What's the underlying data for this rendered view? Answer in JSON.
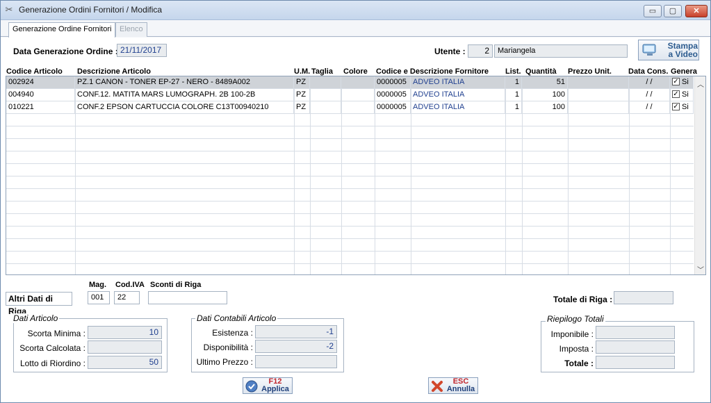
{
  "window": {
    "title": "Generazione Ordini Fornitori / Modifica",
    "minimize": "▭",
    "maximize": "▢",
    "close": "✕"
  },
  "tabs": [
    {
      "label": "Generazione Ordine Fornitori"
    },
    {
      "label": "Elenco"
    }
  ],
  "header": {
    "data_label": "Data Generazione Ordine :",
    "data_value": "21/11/2017",
    "utente_label": "Utente :",
    "utente_id": "2",
    "utente_name": "Mariangela",
    "stampa_label_1": "Stampa",
    "stampa_label_2": "a Video"
  },
  "table": {
    "columns": [
      "Codice Articolo",
      "Descrizione Articolo",
      "U.M.",
      "Taglia",
      "Colore",
      "Codice e Descrizione Fornitore",
      "List.",
      "Quantità",
      "Prezzo Unit.",
      "Data Cons.",
      "Genera"
    ],
    "rows": [
      {
        "codice": "002924",
        "descrizione": "PZ.1 CANON - TONER EP-27 - NERO - 8489A002",
        "um": "PZ",
        "taglia": "",
        "colore": "",
        "cod_forn": "0000005",
        "fornitore": "ADVEO ITALIA",
        "list": "1",
        "quantita": "51",
        "prezzo": "",
        "data_cons": "/ /",
        "genera": "Si"
      },
      {
        "codice": "004940",
        "descrizione": "CONF.12. MATITA MARS LUMOGRAPH. 2B 100-2B",
        "um": "PZ",
        "taglia": "",
        "colore": "",
        "cod_forn": "0000005",
        "fornitore": "ADVEO ITALIA",
        "list": "1",
        "quantita": "100",
        "prezzo": "",
        "data_cons": "/ /",
        "genera": "Si"
      },
      {
        "codice": "010221",
        "descrizione": "CONF.2 EPSON CARTUCCIA COLORE C13T00940210",
        "um": "PZ",
        "taglia": "",
        "colore": "",
        "cod_forn": "0000005",
        "fornitore": "ADVEO ITALIA",
        "list": "1",
        "quantita": "100",
        "prezzo": "",
        "data_cons": "/ /",
        "genera": "Si"
      }
    ]
  },
  "riga": {
    "altri_label": "Altri Dati di Riga",
    "mag_label": "Mag.",
    "mag_value": "001",
    "codiva_label": "Cod.IVA",
    "codiva_value": "22",
    "sconti_label": "Sconti di Riga",
    "sconti_value": "",
    "totale_label": "Totale di Riga :",
    "totale_value": ""
  },
  "dati_articolo": {
    "title": "Dati Articolo",
    "scorta_minima_label": "Scorta Minima :",
    "scorta_minima": "10",
    "scorta_calcolata_label": "Scorta Calcolata :",
    "scorta_calcolata": "",
    "lotto_label": "Lotto di Riordino :",
    "lotto": "50"
  },
  "dati_contabili": {
    "title": "Dati Contabili Articolo",
    "esistenza_label": "Esistenza :",
    "esistenza": "-1",
    "disponibilita_label": "Disponibilità :",
    "disponibilita": "-2",
    "ultimo_prezzo_label": "Ultimo Prezzo :",
    "ultimo_prezzo": ""
  },
  "riepilogo": {
    "title": "Riepilogo Totali",
    "imponibile_label": "Imponibile :",
    "imponibile": "",
    "imposta_label": "Imposta :",
    "imposta": "",
    "totale_label": "Totale :",
    "totale": ""
  },
  "buttons": {
    "applica_key": "F12",
    "applica_label": "Applica",
    "annulla_key": "ESC",
    "annulla_label": "Annulla"
  },
  "icons": {
    "app": "scissors-icon",
    "check": "check-icon",
    "ok": "ok-icon",
    "cancel": "cancel-x-icon",
    "print": "monitor-print-icon"
  }
}
